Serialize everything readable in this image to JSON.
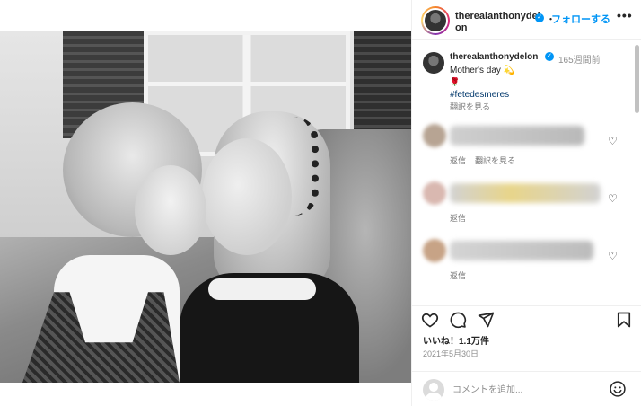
{
  "photo": {
    "alt": ""
  },
  "header": {
    "username": "therealanthonydelon",
    "dot": "・",
    "follow_label": "フォローする",
    "more_label": "•••"
  },
  "caption": {
    "username": "therealanthonydelon",
    "time": "165週間前",
    "text": "Mother's day",
    "sparkle": "💫",
    "rose": "🌹",
    "hashtag": "#fetedesmeres",
    "translate": "翻訳を見る"
  },
  "comments": [
    {
      "reply": "返信",
      "translate": "翻訳を見る"
    },
    {
      "reply": "返信"
    },
    {
      "reply": "返信"
    }
  ],
  "actions": {
    "like_icon": "heart-icon",
    "comment_icon": "comment-icon",
    "share_icon": "share-icon",
    "save_icon": "bookmark-icon"
  },
  "likes": "いいね！1.1万件",
  "date": "2021年5月30日",
  "add_comment": {
    "placeholder": "コメントを追加..."
  },
  "colors": {
    "accent": "#0095f6",
    "text": "#262626",
    "muted": "#8e8e8e"
  }
}
